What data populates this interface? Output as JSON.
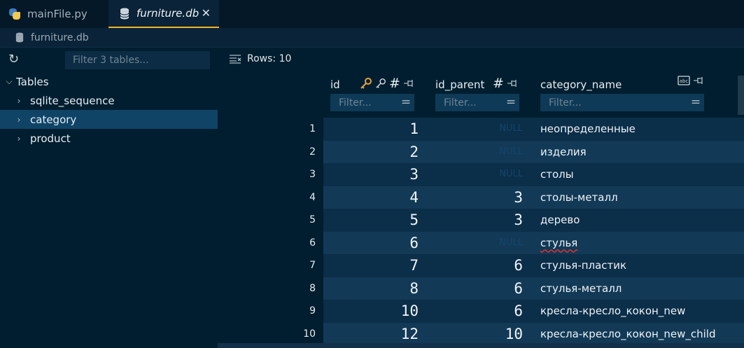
{
  "tabs": [
    {
      "label": "mainFile.py",
      "icon": "python-icon",
      "active": false
    },
    {
      "label": "furniture.db",
      "icon": "database-icon",
      "active": true,
      "close": "✕"
    }
  ],
  "breadcrumb": {
    "label": "furniture.db"
  },
  "sidebar": {
    "filter_placeholder": "Filter 3 tables...",
    "root_label": "Tables",
    "items": [
      {
        "label": "sqlite_sequence"
      },
      {
        "label": "category",
        "selected": true
      },
      {
        "label": "product"
      }
    ]
  },
  "grid": {
    "rows_label": "Rows: 10",
    "columns": [
      {
        "name": "id",
        "filter_placeholder": "Filter..."
      },
      {
        "name": "id_parent",
        "filter_placeholder": "Filter..."
      },
      {
        "name": "category_name",
        "filter_placeholder": "Filter..."
      }
    ],
    "null_text": "NULL",
    "rows": [
      {
        "num": "1",
        "id": "1",
        "id_parent": "NULL",
        "category_name": "неопределенные"
      },
      {
        "num": "2",
        "id": "2",
        "id_parent": "NULL",
        "category_name": "изделия"
      },
      {
        "num": "3",
        "id": "3",
        "id_parent": "NULL",
        "category_name": "столы"
      },
      {
        "num": "4",
        "id": "4",
        "id_parent": "3",
        "category_name": "столы-металл"
      },
      {
        "num": "5",
        "id": "5",
        "id_parent": "3",
        "category_name": "дерево"
      },
      {
        "num": "6",
        "id": "6",
        "id_parent": "NULL",
        "category_name": "стулья"
      },
      {
        "num": "7",
        "id": "7",
        "id_parent": "6",
        "category_name": "стулья-пластик"
      },
      {
        "num": "8",
        "id": "8",
        "id_parent": "6",
        "category_name": "стулья-металл"
      },
      {
        "num": "9",
        "id": "10",
        "id_parent": "6",
        "category_name": "кресла-кресло_кокон_new"
      },
      {
        "num": "10",
        "id": "12",
        "id_parent": "10",
        "category_name": "кресла-кресло_кокон_new_child"
      }
    ]
  },
  "colors": {
    "accent": "#f0b429",
    "key_icon": "#e8a33d",
    "selected_row": "#0f4466",
    "row_even": "#0b2e49",
    "row_odd": "#123a57"
  }
}
